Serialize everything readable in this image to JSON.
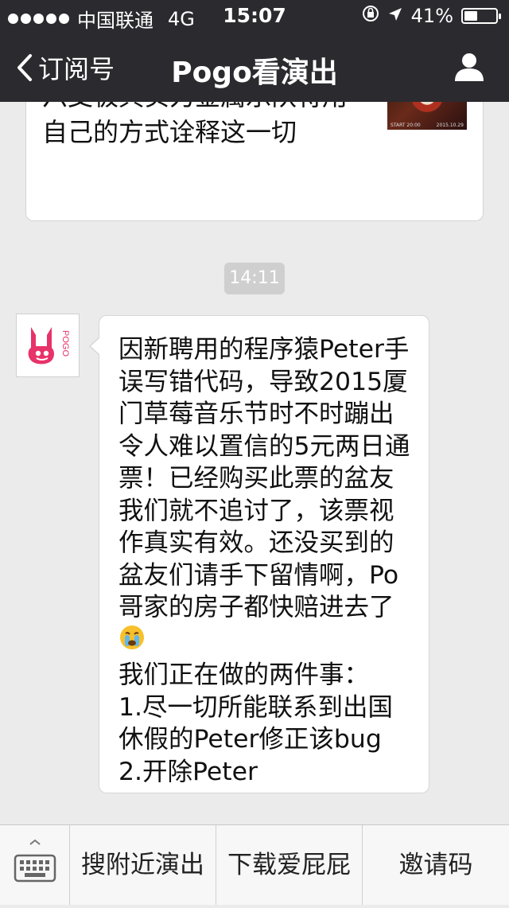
{
  "status": {
    "carrier": "中国联通",
    "network": "4G",
    "time": "15:07",
    "battery": "41%",
    "battery_level": 0.41
  },
  "nav": {
    "back_label": "订阅号",
    "title": "Pogo看演出",
    "profile_icon": "person-icon"
  },
  "article": {
    "text": "六支极具实力金属乐队将用\n自己的方式诠释这一切",
    "thumb_caption_left": "START 20:00",
    "thumb_caption_right": "2015.10.29"
  },
  "chat": {
    "timestamp": "14:11",
    "sender_logo": "POGO",
    "message_part1": "因新聘用的程序猿Peter手\n误写错代码，导致2015厦\n门草莓音乐节时不时蹦出\n令人难以置信的5元两日通\n票！已经购买此票的盆友\n我们就不追讨了，该票视\n作真实有效。还没买到的\n盆友们请手下留情啊，Po\n哥家的房子都快赔进去了",
    "message_emoji": "crying-face-icon",
    "message_part2": "我们正在做的两件事：\n1.尽一切所能联系到出国\n休假的Peter修正该bug\n2.开除Peter"
  },
  "bottom_menu": {
    "keyboard_icon": "keyboard-icon",
    "items": [
      "搜附近演出",
      "下载爱屁屁",
      "邀请码"
    ]
  },
  "colors": {
    "topbar": "#2b2a2f",
    "background": "#ebebeb",
    "brand_pink": "#e8326a"
  }
}
